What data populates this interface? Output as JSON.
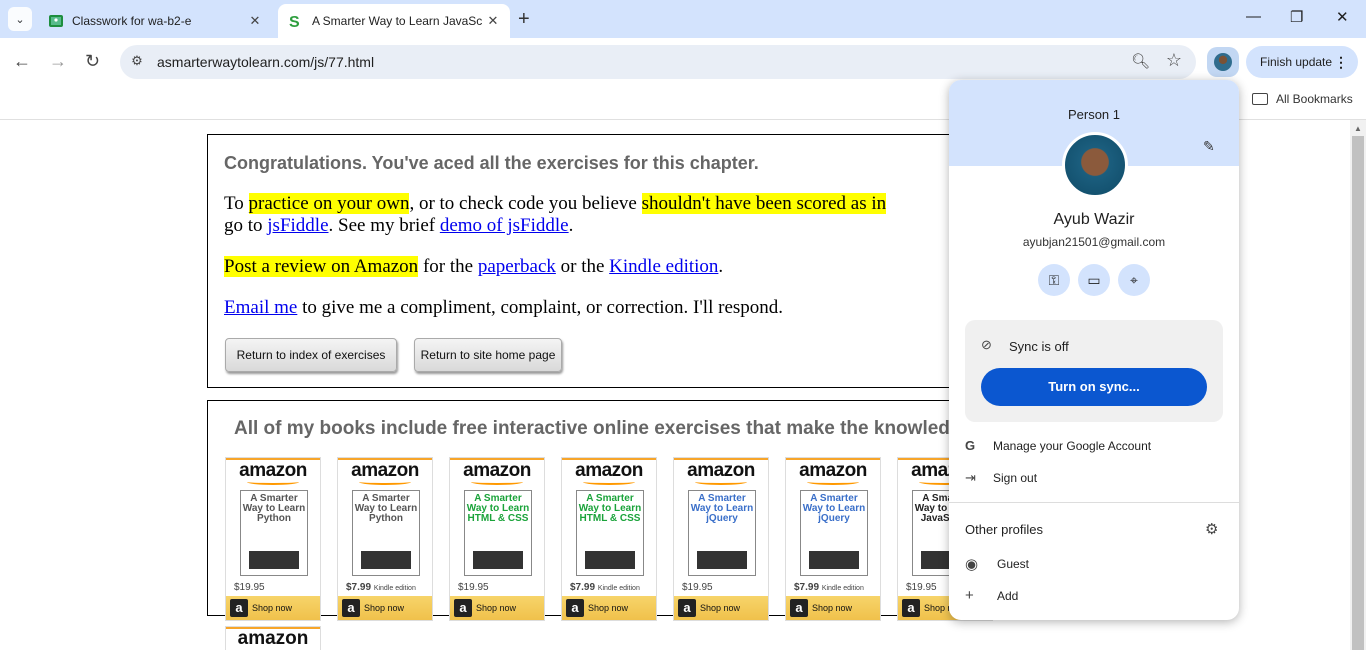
{
  "tabs": [
    {
      "title": "Classwork for wa-b2-e",
      "active": false
    },
    {
      "title": "A Smarter Way to Learn JavaScr",
      "active": true
    }
  ],
  "toolbar": {
    "url": "asmarterwaytolearn.com/js/77.html",
    "finish_update": "Finish update"
  },
  "bookmarks": {
    "all_label": "All Bookmarks"
  },
  "page": {
    "congrats": "Congratulations. You've aced all the exercises for this chapter.",
    "p1_a": "To ",
    "p1_hl1": "practice on your own",
    "p1_b": ", or to check code you believe ",
    "p1_hl2": "shouldn't have been scored as in",
    "p1_c": "go to ",
    "p1_link1": "jsFiddle",
    "p1_d": ". See my brief ",
    "p1_link2": "demo of jsFiddle",
    "p1_e": ".",
    "p2_hl": "Post a review on Amazon",
    "p2_a": " for the ",
    "p2_link1": "paperback",
    "p2_b": " or the ",
    "p2_link2": "Kindle edition",
    "p2_c": ".",
    "p3_link": "Email me",
    "p3_a": " to give me a compliment, complaint, or correction. I'll respond.",
    "btn_index": "Return to index of exercises",
    "btn_home": "Return to site home page",
    "books_heading": "All of my books include free interactive online exercises that make the knowledg"
  },
  "ads": [
    {
      "title": "A Smarter Way to Learn Python",
      "price": "$19.95",
      "kindle": "",
      "color": "#555555"
    },
    {
      "title": "A Smarter Way to Learn Python",
      "price": "$7.99",
      "kindle": "Kindle edition",
      "color": "#555555"
    },
    {
      "title": "A Smarter Way to Learn HTML & CSS",
      "price": "$19.95",
      "kindle": "",
      "color": "#1aa33a"
    },
    {
      "title": "A Smarter Way to Learn HTML & CSS",
      "price": "$7.99",
      "kindle": "Kindle edition",
      "color": "#1aa33a"
    },
    {
      "title": "A Smarter Way to Learn jQuery",
      "price": "$19.95",
      "kindle": "",
      "color": "#3a6fc9"
    },
    {
      "title": "A Smarter Way to Learn jQuery",
      "price": "$7.99",
      "kindle": "Kindle edition",
      "color": "#3a6fc9"
    },
    {
      "title": "A Smarter Way to Learn JavaScript",
      "price": "$19.95",
      "kindle": "",
      "color": "#222222"
    }
  ],
  "ad_brand": "amazon",
  "ad_shop": "Shop now",
  "profile_menu": {
    "person_label": "Person 1",
    "name": "Ayub Wazir",
    "email": "ayubjan21501@gmail.com",
    "sync_status": "Sync is off",
    "sync_button": "Turn on sync...",
    "manage_account": "Manage your Google Account",
    "sign_out": "Sign out",
    "other_profiles": "Other profiles",
    "guest": "Guest",
    "add": "Add"
  }
}
